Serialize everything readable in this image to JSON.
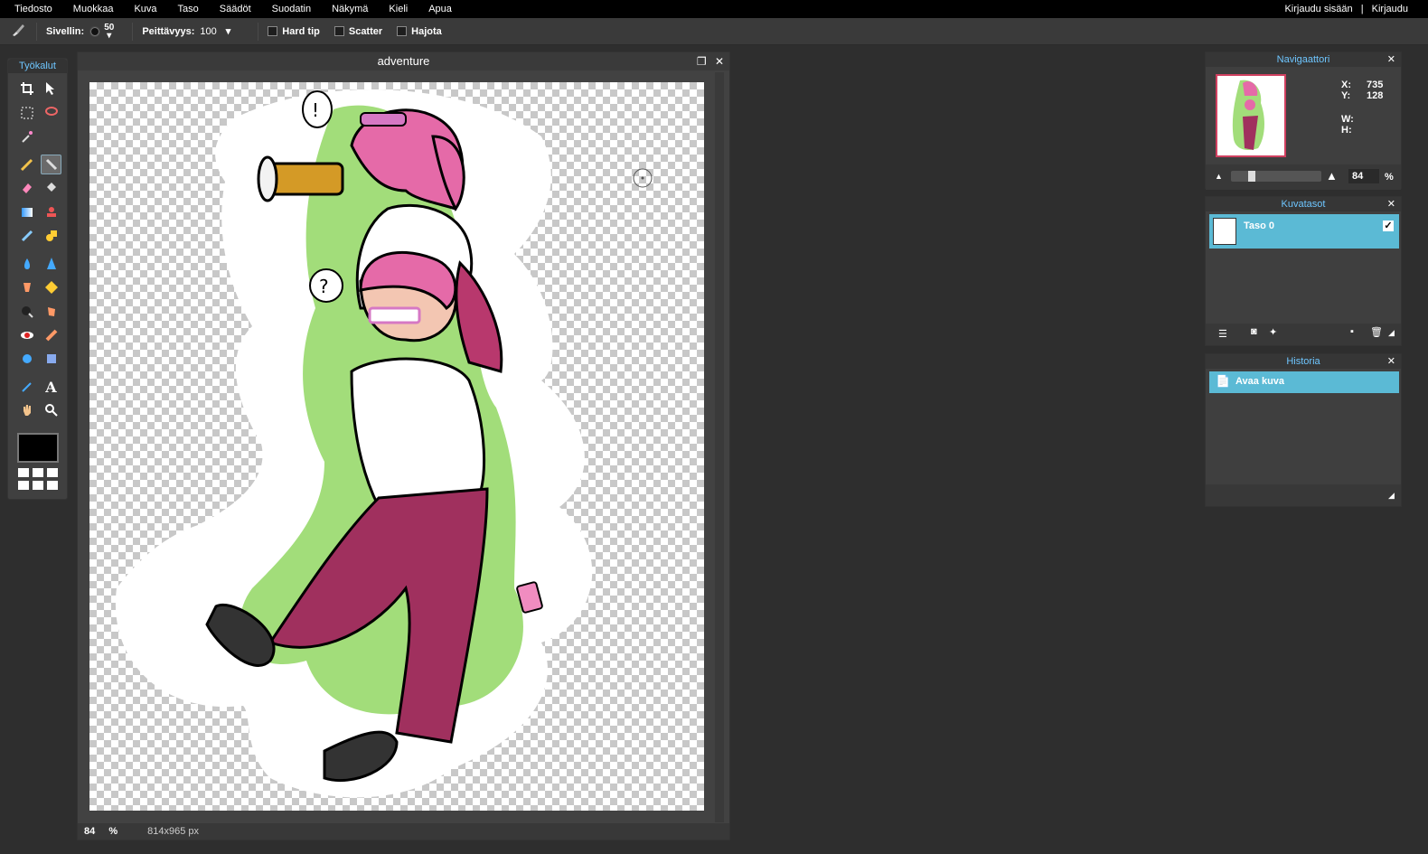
{
  "menu": [
    "Tiedosto",
    "Muokkaa",
    "Kuva",
    "Taso",
    "Säädöt",
    "Suodatin",
    "Näkymä",
    "Kieli",
    "Apua"
  ],
  "auth": {
    "login": "Kirjaudu sisään",
    "sep": "|",
    "signup": "Kirjaudu"
  },
  "options": {
    "brush_label": "Sivellin:",
    "brush_size": "50",
    "opacity_label": "Peittävyys:",
    "opacity_value": "100",
    "hard_tip": "Hard tip",
    "scatter": "Scatter",
    "hajota": "Hajota"
  },
  "toolbox": {
    "title": "Työkalut"
  },
  "document": {
    "title": "adventure",
    "zoom": "84",
    "zoom_unit": "%",
    "size": "814x965 px"
  },
  "navigator": {
    "title": "Navigaattori",
    "x_label": "X:",
    "x_value": "735",
    "y_label": "Y:",
    "y_value": "128",
    "w_label": "W:",
    "h_label": "H:",
    "zoom": "84",
    "zoom_unit": "%"
  },
  "layers": {
    "title": "Kuvatasot",
    "items": [
      {
        "name": "Taso 0",
        "visible": true
      }
    ]
  },
  "history": {
    "title": "Historia",
    "items": [
      "Avaa kuva"
    ]
  },
  "colors": {
    "accent": "#5bbad5",
    "foreground": "#000000",
    "title": "#6ec6ff"
  }
}
